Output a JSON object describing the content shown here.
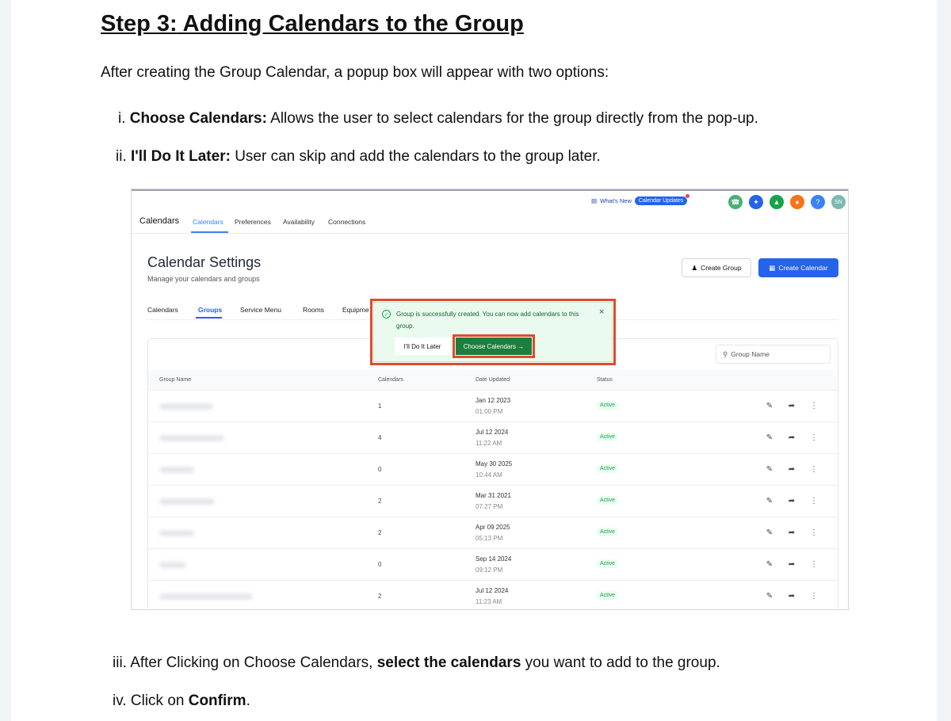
{
  "doc": {
    "heading_bold": "Step 3:",
    "heading_rest": " Adding Calendars to the Group",
    "intro": "After creating the Group Calendar, a popup box will appear with two options:",
    "items": [
      {
        "num": "i. ",
        "bold": "Choose Calendars:",
        "rest": " Allows the user to select calendars for the group directly from the pop-up."
      },
      {
        "num": "ii. ",
        "bold": "I'll Do It Later:",
        "rest": " User can skip and add the calendars to the group later."
      },
      {
        "num": "iii. ",
        "pre": "After Clicking on Choose Calendars, ",
        "bold": "select the calendars",
        "rest": " you want to add to the group."
      },
      {
        "num": "iv. ",
        "pre": "Click on ",
        "bold": "Confirm",
        "rest": "."
      }
    ]
  },
  "app": {
    "title": "Calendars",
    "nav": [
      "Calendars",
      "Preferences",
      "Availability",
      "Connections"
    ],
    "whats_new": "What's New",
    "updates_pill": "Calendar Updates",
    "avatar": "SN",
    "help": "?",
    "page_title": "Calendar Settings",
    "page_sub": "Manage your calendars and groups",
    "create_group": "Create Group",
    "create_calendar": "Create Calendar",
    "subtabs": [
      "Calendars",
      "Groups",
      "Service Menu",
      "Rooms",
      "Equipme"
    ],
    "search_placeholder": "Group Name",
    "columns": [
      "Group Name",
      "Calendars",
      "Date Updated",
      "Status"
    ],
    "rows": [
      {
        "calendars": "1",
        "date": "Jan 12 2023",
        "time": "01:00 PM",
        "status": "Active"
      },
      {
        "calendars": "4",
        "date": "Jul 12 2024",
        "time": "11:22 AM",
        "status": "Active"
      },
      {
        "calendars": "0",
        "date": "May 30 2025",
        "time": "10:44 AM",
        "status": "Active"
      },
      {
        "calendars": "2",
        "date": "Mar 31 2021",
        "time": "07:27 PM",
        "status": "Active"
      },
      {
        "calendars": "2",
        "date": "Apr 09 2025",
        "time": "05:13 PM",
        "status": "Active"
      },
      {
        "calendars": "0",
        "date": "Sep 14 2024",
        "time": "09:12 PM",
        "status": "Active"
      },
      {
        "calendars": "2",
        "date": "Jul 12 2024",
        "time": "11:23 AM",
        "status": "Active"
      }
    ],
    "toast": {
      "message": "Group is successfully created. You can now add calendars to this group.",
      "later": "I'll Do It Later",
      "choose": "Choose Calendars →",
      "close": "×"
    }
  },
  "colors": {
    "accent": "#2563eb",
    "highlight": "#e04a2d",
    "success": "#16a34a"
  }
}
